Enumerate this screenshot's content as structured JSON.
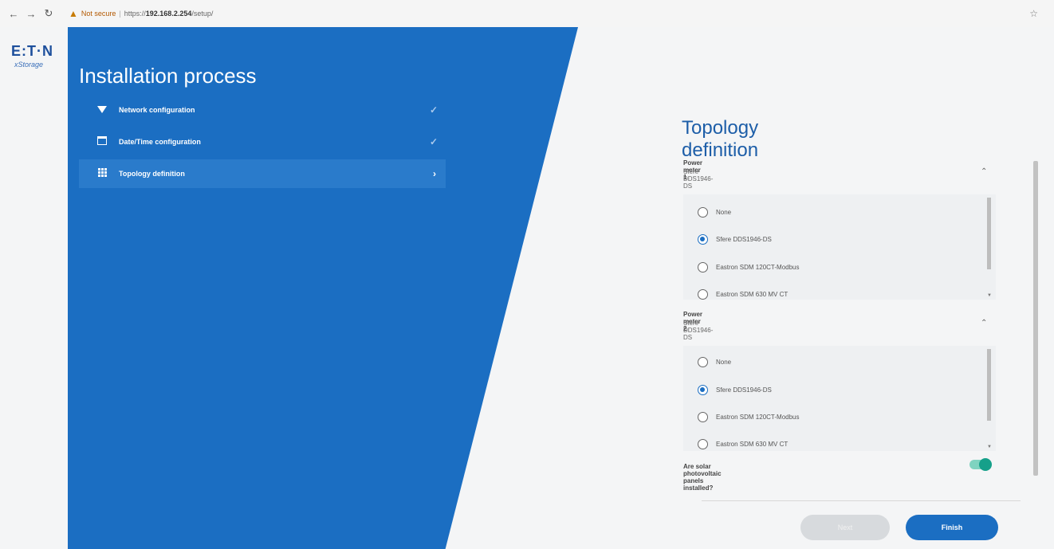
{
  "browser": {
    "not_secure_label": "Not secure",
    "separator": "|",
    "url_prefix": "https://",
    "url_host": "192.168.2.254",
    "url_path": "/setup/"
  },
  "logo": {
    "brand": "E:T·N",
    "product": "xStorage"
  },
  "sidebar": {
    "title": "Installation process",
    "steps": [
      {
        "label": "Network configuration",
        "icon": "wifi-icon",
        "state": "done"
      },
      {
        "label": "Date/Time configuration",
        "icon": "calendar-icon",
        "state": "done"
      },
      {
        "label": "Topology definition",
        "icon": "grid-icon",
        "state": "active"
      }
    ]
  },
  "main": {
    "title": "Topology definition",
    "power_meter_1": {
      "label": "Power meter 1",
      "value": "Sfere DDS1946-DS",
      "options": [
        "None",
        "Sfere DDS1946-DS",
        "Eastron SDM 120CT-Modbus",
        "Eastron SDM 630 MV CT"
      ],
      "selected_index": 1
    },
    "power_meter_2": {
      "label": "Power meter 2",
      "value": "Sfere DDS1946-DS",
      "options": [
        "None",
        "Sfere DDS1946-DS",
        "Eastron SDM 120CT-Modbus",
        "Eastron SDM 630 MV CT"
      ],
      "selected_index": 1
    },
    "solar_question": "Are solar photovoltaic panels installed?",
    "solar_enabled": true
  },
  "footer": {
    "next_label": "Next",
    "finish_label": "Finish"
  },
  "colors": {
    "primary": "#1b6ec2",
    "toggle_on": "#16a08a",
    "title": "#1d5ea8"
  }
}
